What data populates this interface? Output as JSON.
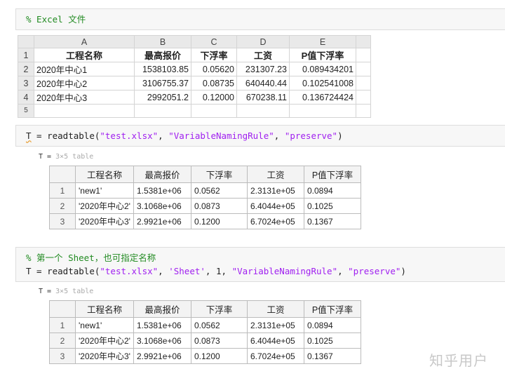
{
  "cells": [
    {
      "comment": "% Excel 文件"
    },
    {
      "var": "T",
      "fn": "readtable(",
      "args": [
        "\"test.xlsx\"",
        "\"VariableNamingRule\"",
        "\"preserve\""
      ]
    },
    {
      "comment": "% 第一个 Sheet，也可指定名称",
      "var": "T",
      "fn": "readtable(",
      "args": [
        "\"test.xlsx\"",
        "'Sheet'",
        "1",
        "\"VariableNamingRule\"",
        "\"preserve\""
      ]
    }
  ],
  "excel": {
    "col_letters": [
      "A",
      "B",
      "C",
      "D",
      "E"
    ],
    "row_numbers": [
      "1",
      "2",
      "3",
      "4",
      "5"
    ],
    "headers": [
      "工程名称",
      "最高报价",
      "下浮率",
      "工资",
      "P值下浮率"
    ],
    "rows": [
      [
        "2020年中心1",
        "1538103.85",
        "0.05620",
        "231307.23",
        "0.089434201"
      ],
      [
        "2020年中心2",
        "3106755.37",
        "0.08735",
        "640440.44",
        "0.102541008"
      ],
      [
        "2020年中心3",
        "2992051.2",
        "0.12000",
        "670238.11",
        "0.136724424"
      ]
    ]
  },
  "output": {
    "label": "T =",
    "size": "3×5 table",
    "headers": [
      "工程名称",
      "最高报价",
      "下浮率",
      "工资",
      "P值下浮率"
    ],
    "rows": [
      [
        "1",
        "'new1'",
        "1.5381e+06",
        "0.0562",
        "2.3131e+05",
        "0.0894"
      ],
      [
        "2",
        "'2020年中心2'",
        "3.1068e+06",
        "0.0873",
        "6.4044e+05",
        "0.1025"
      ],
      [
        "3",
        "'2020年中心3'",
        "2.9921e+06",
        "0.1200",
        "6.7024e+05",
        "0.1367"
      ]
    ]
  },
  "watermark": "知乎用户"
}
